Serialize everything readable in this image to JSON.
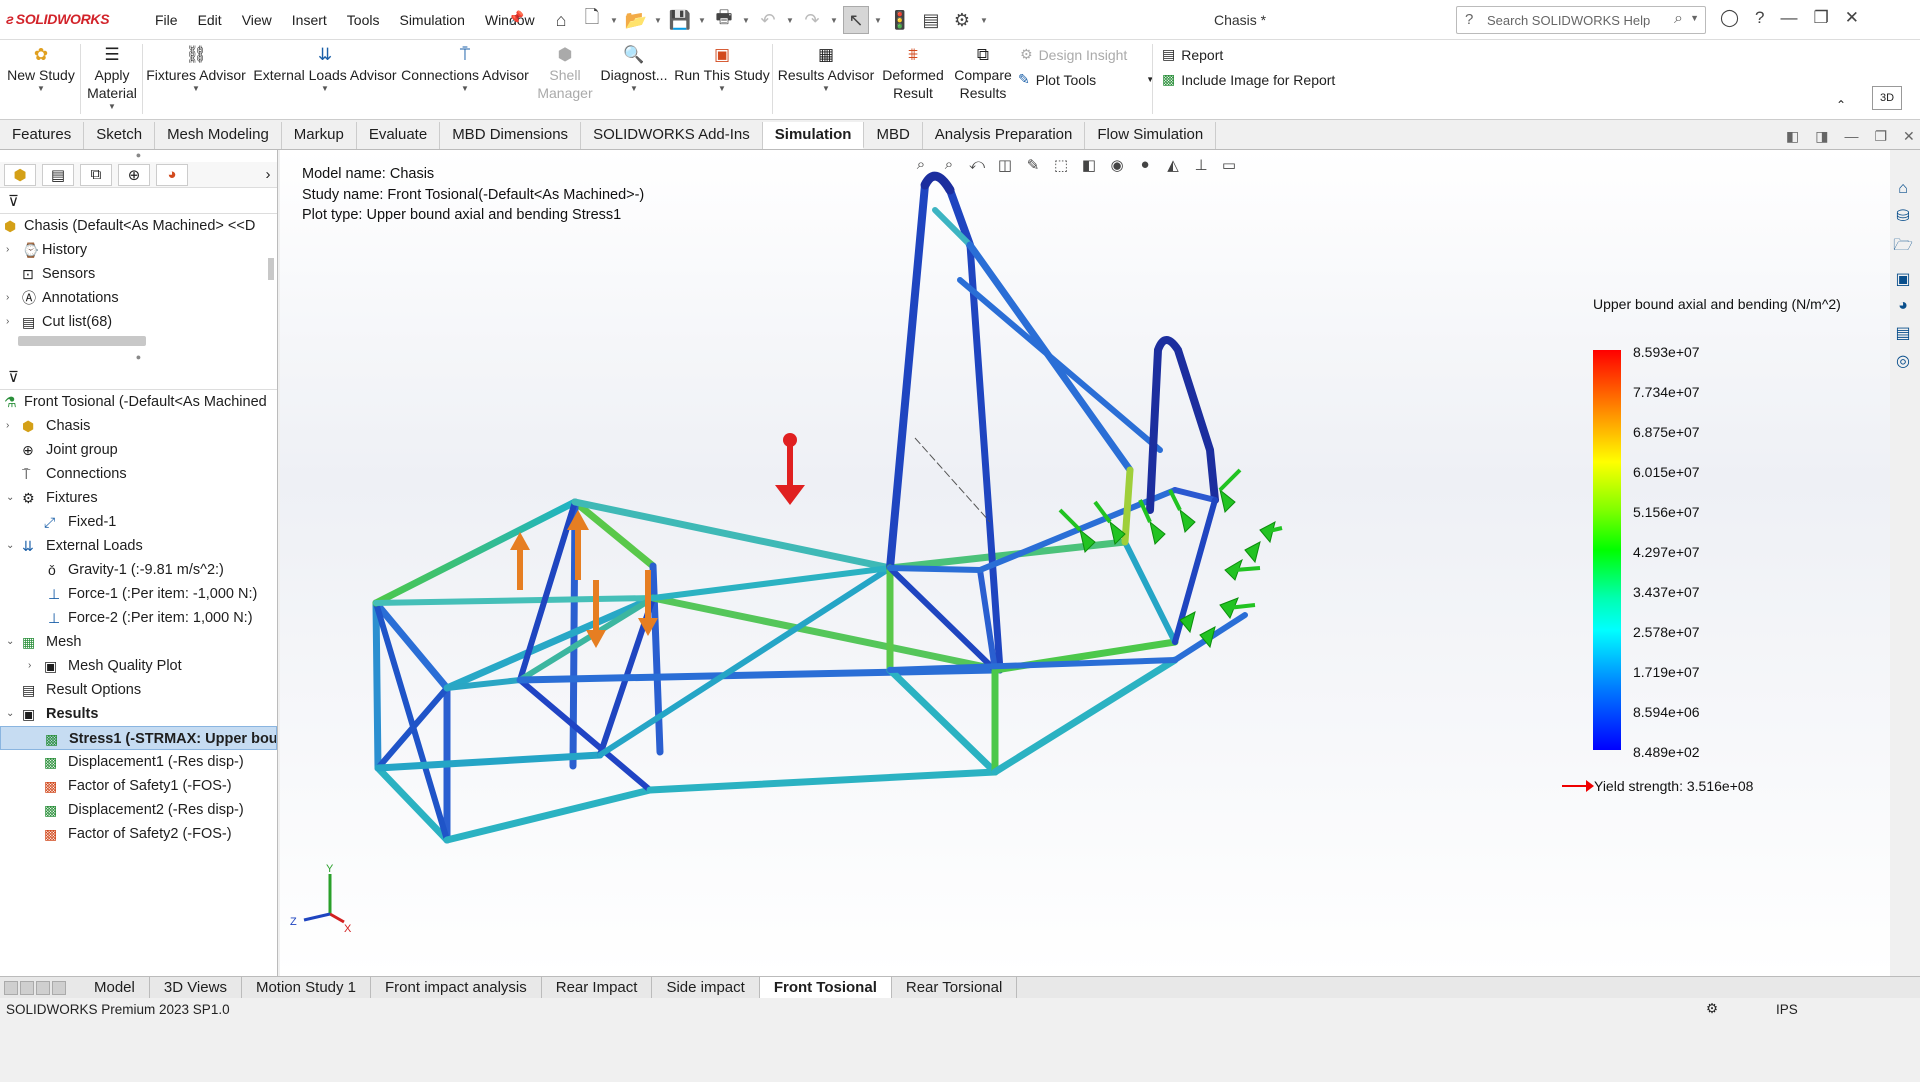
{
  "app": {
    "logo_text": "SOLIDWORKS",
    "menus": [
      "File",
      "Edit",
      "View",
      "Insert",
      "Tools",
      "Simulation",
      "Window"
    ],
    "doc_title": "Chasis *",
    "search_placeholder": "Search SOLIDWORKS Help"
  },
  "ribbon": {
    "new_study": "New Study",
    "apply_material_1": "Apply",
    "apply_material_2": "Material",
    "fixtures_advisor": "Fixtures Advisor",
    "external_loads_advisor": "External Loads Advisor",
    "connections_advisor": "Connections Advisor",
    "shell_manager_1": "Shell",
    "shell_manager_2": "Manager",
    "diagnostics": "Diagnost...",
    "run_study": "Run This Study",
    "results_advisor": "Results Advisor",
    "deformed_1": "Deformed",
    "deformed_2": "Result",
    "compare_1": "Compare",
    "compare_2": "Results",
    "design_insight": "Design Insight",
    "plot_tools": "Plot Tools",
    "report": "Report",
    "include_image": "Include Image for Report",
    "view_3d": "3D"
  },
  "tabs": [
    "Features",
    "Sketch",
    "Mesh Modeling",
    "Markup",
    "Evaluate",
    "MBD Dimensions",
    "SOLIDWORKS Add-Ins",
    "Simulation",
    "MBD",
    "Analysis Preparation",
    "Flow Simulation"
  ],
  "active_tab": "Simulation",
  "feature_tree": {
    "root": "Chasis (Default<As Machined> <<D",
    "items": [
      "History",
      "Sensors",
      "Annotations",
      "Cut list(68)"
    ]
  },
  "study_tree": {
    "root": "Front Tosional (-Default<As Machined",
    "chasis": "Chasis",
    "joint_group": "Joint group",
    "connections": "Connections",
    "fixtures": "Fixtures",
    "fixed1": "Fixed-1",
    "external_loads": "External Loads",
    "gravity1": "Gravity-1 (:-9.81 m/s^2:)",
    "force1": "Force-1 (:Per item: -1,000 N:)",
    "force2": "Force-2 (:Per item: 1,000 N:)",
    "mesh": "Mesh",
    "mesh_quality": "Mesh Quality Plot",
    "result_options": "Result Options",
    "results": "Results",
    "stress1": "Stress1 (-STRMAX: Upper bou",
    "displacement1": "Displacement1 (-Res disp-)",
    "fos1": "Factor of Safety1 (-FOS-)",
    "displacement2": "Displacement2 (-Res disp-)",
    "fos2": "Factor of Safety2 (-FOS-)"
  },
  "viewport": {
    "model_name": "Model name: Chasis",
    "study_name": "Study name: Front Tosional(-Default<As Machined>-)",
    "plot_type": "Plot type: Upper bound axial and bending Stress1"
  },
  "legend": {
    "title": "Upper bound axial and bending (N/m^2)",
    "ticks": [
      "8.593e+07",
      "7.734e+07",
      "6.875e+07",
      "6.015e+07",
      "5.156e+07",
      "4.297e+07",
      "3.437e+07",
      "2.578e+07",
      "1.719e+07",
      "8.594e+06",
      "8.489e+02"
    ],
    "yield": "Yield strength: 3.516e+08"
  },
  "triad": {
    "x": "X",
    "y": "Y",
    "z": "Z"
  },
  "bottom_tabs": [
    "Model",
    "3D Views",
    "Motion Study 1",
    "Front impact analysis",
    "Rear Impact",
    "Side impact",
    "Front Tosional",
    "Rear Torsional"
  ],
  "active_bottom_tab": "Front Tosional",
  "status": {
    "left": "SOLIDWORKS Premium 2023 SP1.0",
    "units": "IPS"
  },
  "colors": {
    "accent": "#d2232a",
    "selection": "#c6dcf2",
    "load_arrow": "#e67e22",
    "fixture": "#22c322"
  }
}
